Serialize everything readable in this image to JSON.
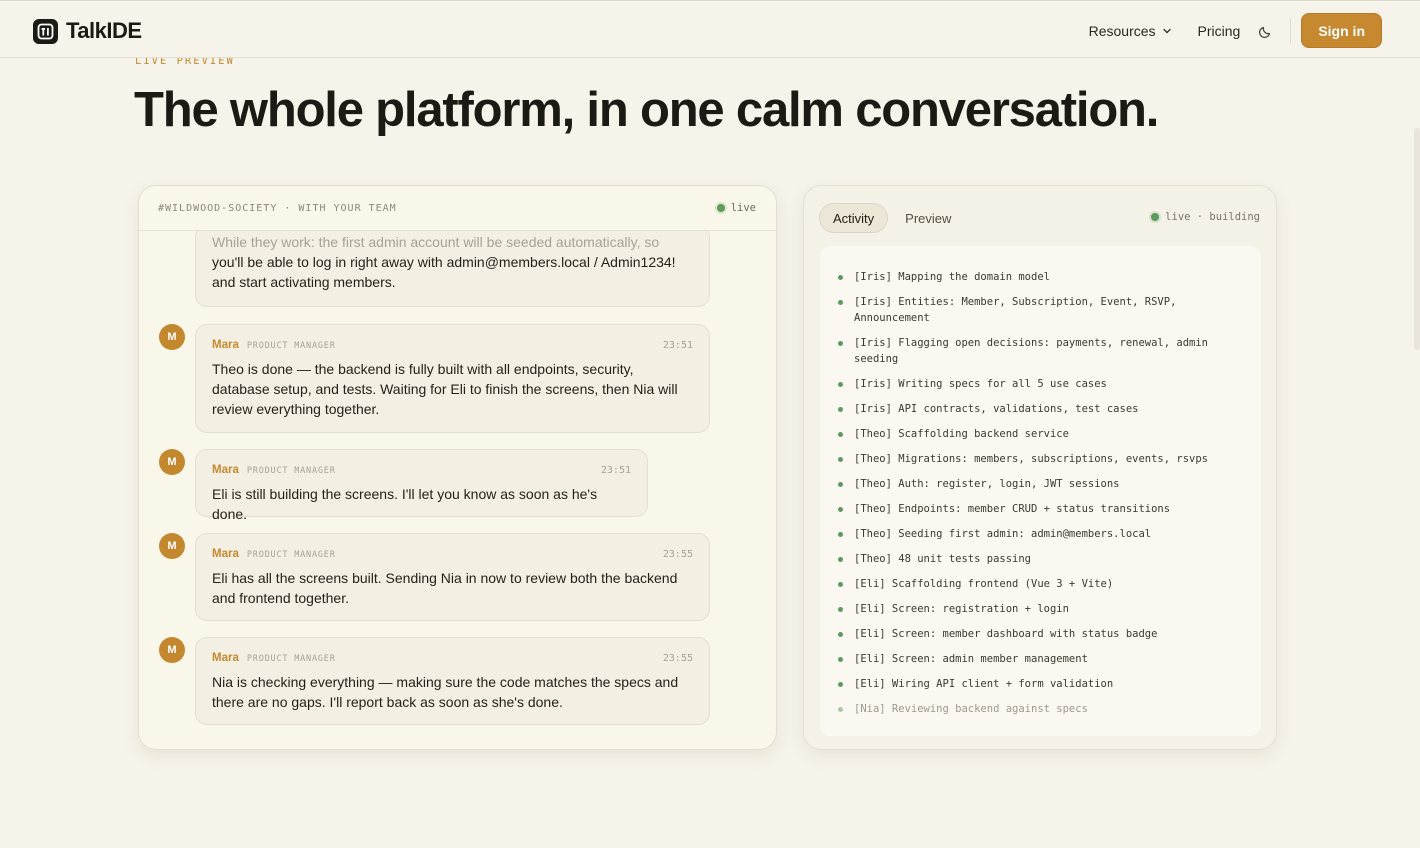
{
  "header": {
    "brand": "TalkIDE",
    "nav_resources": "Resources",
    "nav_pricing": "Pricing",
    "signin_label": "Sign in"
  },
  "hero": {
    "eyebrow": "LIVE PREVIEW",
    "headline": "The whole platform, in one calm conversation."
  },
  "chat": {
    "channel": "#WILDWOOD-SOCIETY · WITH YOUR TEAM",
    "status": "live",
    "partial_faded": "While they work: the first admin account will be seeded automatically, so",
    "partial_text": "you'll be able to log in right away with admin@members.local / Admin1234! and start activating members.",
    "messages": [
      {
        "initial": "M",
        "sender": "Mara",
        "role": "PRODUCT MANAGER",
        "time": "23:51",
        "text": "Theo is done — the backend is fully built with all endpoints, security, database setup, and tests. Waiting for Eli to finish the screens, then Nia will review everything together."
      },
      {
        "initial": "M",
        "sender": "Mara",
        "role": "PRODUCT MANAGER",
        "time": "23:51",
        "text": "Eli is still building the screens. I'll let you know as soon as he's done."
      },
      {
        "initial": "M",
        "sender": "Mara",
        "role": "PRODUCT MANAGER",
        "time": "23:55",
        "text": "Eli has all the screens built. Sending Nia in now to review both the backend and frontend together."
      },
      {
        "initial": "M",
        "sender": "Mara",
        "role": "PRODUCT MANAGER",
        "time": "23:55",
        "text": "Nia is checking everything — making sure the code matches the specs and there are no gaps. I'll report back as soon as she's done."
      }
    ]
  },
  "activity": {
    "tab_activity": "Activity",
    "tab_preview": "Preview",
    "status": "live · building",
    "log": [
      "[Iris] Mapping the domain model",
      "[Iris] Entities: Member, Subscription, Event, RSVP, Announcement",
      "[Iris] Flagging open decisions: payments, renewal, admin seeding",
      "[Iris] Writing specs for all 5 use cases",
      "[Iris] API contracts, validations, test cases",
      "[Theo] Scaffolding backend service",
      "[Theo] Migrations: members, subscriptions, events, rsvps",
      "[Theo] Auth: register, login, JWT sessions",
      "[Theo] Endpoints: member CRUD + status transitions",
      "[Theo] Seeding first admin: admin@members.local",
      "[Theo] 48 unit tests passing",
      "[Eli] Scaffolding frontend (Vue 3 + Vite)",
      "[Eli] Screen: registration + login",
      "[Eli] Screen: member dashboard with status badge",
      "[Eli] Screen: admin member management",
      "[Eli] Wiring API client + form validation"
    ],
    "pending": "[Nia] Reviewing backend against specs"
  },
  "colors": {
    "accent": "#c6892f",
    "live": "#5d9a5d",
    "background": "#f6f3ea"
  },
  "icons": [
    "logo-icon",
    "chevron-down-icon",
    "moon-icon"
  ]
}
